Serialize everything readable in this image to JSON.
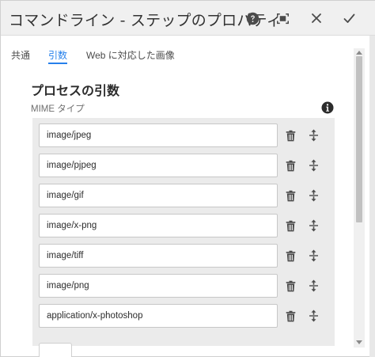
{
  "dialog": {
    "title": "コマンドライン - ステップのプロパティ"
  },
  "toolbar": {
    "help_icon": "help-circle-icon",
    "fullscreen_icon": "fullscreen-icon",
    "close_icon": "close-icon",
    "done_icon": "checkmark-icon"
  },
  "tabs": [
    {
      "label": "共通"
    },
    {
      "label": "引数",
      "active": true
    },
    {
      "label": "Web に対応した画像"
    }
  ],
  "section": {
    "title": "プロセスの引数",
    "field_label": "MIME タイプ",
    "info_icon": "info-icon"
  },
  "mime_types": [
    {
      "value": "image/jpeg"
    },
    {
      "value": "image/pjpeg"
    },
    {
      "value": "image/gif"
    },
    {
      "value": "image/x-png"
    },
    {
      "value": "image/tiff"
    },
    {
      "value": "image/png"
    },
    {
      "value": "application/x-photoshop"
    }
  ],
  "row_icons": {
    "delete_icon": "trash-icon",
    "move_icon": "move-vertical-icon"
  },
  "colors": {
    "accent": "#2680eb",
    "icon": "#6e6e6e",
    "multifield_bg": "#ebebeb"
  }
}
